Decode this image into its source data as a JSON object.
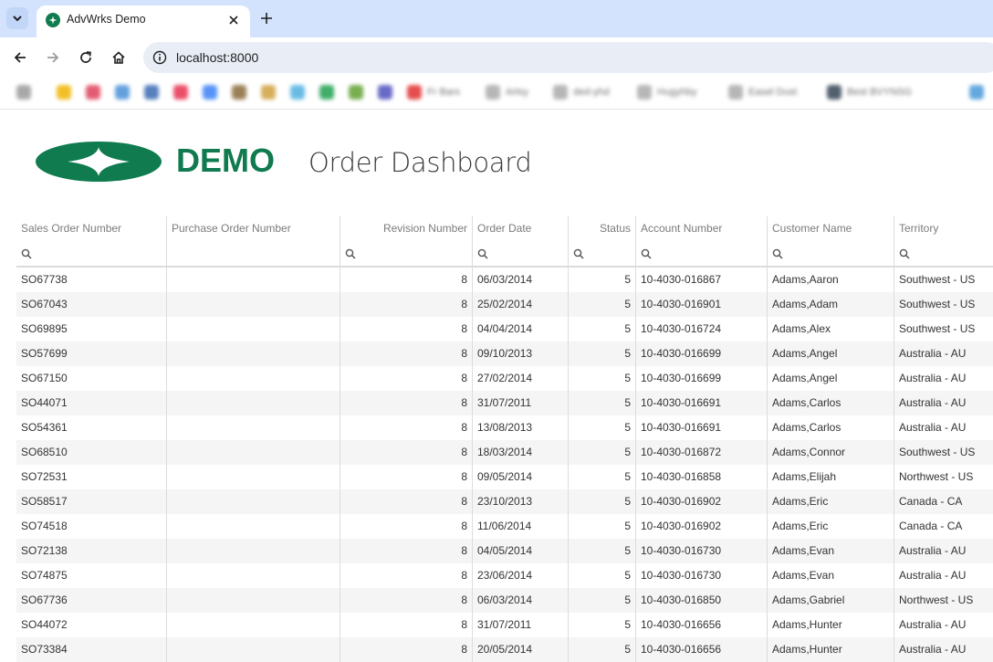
{
  "browser": {
    "tab_title": "AdvWrks Demo",
    "url": "localhost:8000",
    "bookmark_labels": [
      "Fr Bars",
      "Artsy",
      "ded-yhd",
      "Hugyhby",
      "Easel Dust",
      "Best BVYNSG"
    ]
  },
  "colors": {
    "brand_green": "#0f7b4f",
    "header_text": "#7b7b7b",
    "row_alt": "#f5f5f5",
    "tabstrip": "#d3e3fd"
  },
  "header": {
    "logo_text": "DEMO",
    "title": "Order Dashboard"
  },
  "grid": {
    "columns": [
      "Sales Order Number",
      "Purchase Order Number",
      "Revision Number",
      "Order Date",
      "Status",
      "Account Number",
      "Customer Name",
      "Territory"
    ],
    "rows": [
      [
        "SO67738",
        "",
        "8",
        "06/03/2014",
        "5",
        "10-4030-016867",
        "Adams,Aaron",
        "Southwest - US"
      ],
      [
        "SO67043",
        "",
        "8",
        "25/02/2014",
        "5",
        "10-4030-016901",
        "Adams,Adam",
        "Southwest - US"
      ],
      [
        "SO69895",
        "",
        "8",
        "04/04/2014",
        "5",
        "10-4030-016724",
        "Adams,Alex",
        "Southwest - US"
      ],
      [
        "SO57699",
        "",
        "8",
        "09/10/2013",
        "5",
        "10-4030-016699",
        "Adams,Angel",
        "Australia - AU"
      ],
      [
        "SO67150",
        "",
        "8",
        "27/02/2014",
        "5",
        "10-4030-016699",
        "Adams,Angel",
        "Australia - AU"
      ],
      [
        "SO44071",
        "",
        "8",
        "31/07/2011",
        "5",
        "10-4030-016691",
        "Adams,Carlos",
        "Australia - AU"
      ],
      [
        "SO54361",
        "",
        "8",
        "13/08/2013",
        "5",
        "10-4030-016691",
        "Adams,Carlos",
        "Australia - AU"
      ],
      [
        "SO68510",
        "",
        "8",
        "18/03/2014",
        "5",
        "10-4030-016872",
        "Adams,Connor",
        "Southwest - US"
      ],
      [
        "SO72531",
        "",
        "8",
        "09/05/2014",
        "5",
        "10-4030-016858",
        "Adams,Elijah",
        "Northwest - US"
      ],
      [
        "SO58517",
        "",
        "8",
        "23/10/2013",
        "5",
        "10-4030-016902",
        "Adams,Eric",
        "Canada - CA"
      ],
      [
        "SO74518",
        "",
        "8",
        "11/06/2014",
        "5",
        "10-4030-016902",
        "Adams,Eric",
        "Canada - CA"
      ],
      [
        "SO72138",
        "",
        "8",
        "04/05/2014",
        "5",
        "10-4030-016730",
        "Adams,Evan",
        "Australia - AU"
      ],
      [
        "SO74875",
        "",
        "8",
        "23/06/2014",
        "5",
        "10-4030-016730",
        "Adams,Evan",
        "Australia - AU"
      ],
      [
        "SO67736",
        "",
        "8",
        "06/03/2014",
        "5",
        "10-4030-016850",
        "Adams,Gabriel",
        "Northwest - US"
      ],
      [
        "SO44072",
        "",
        "8",
        "31/07/2011",
        "5",
        "10-4030-016656",
        "Adams,Hunter",
        "Australia - AU"
      ],
      [
        "SO73384",
        "",
        "8",
        "20/05/2014",
        "5",
        "10-4030-016656",
        "Adams,Hunter",
        "Australia - AU"
      ]
    ]
  }
}
